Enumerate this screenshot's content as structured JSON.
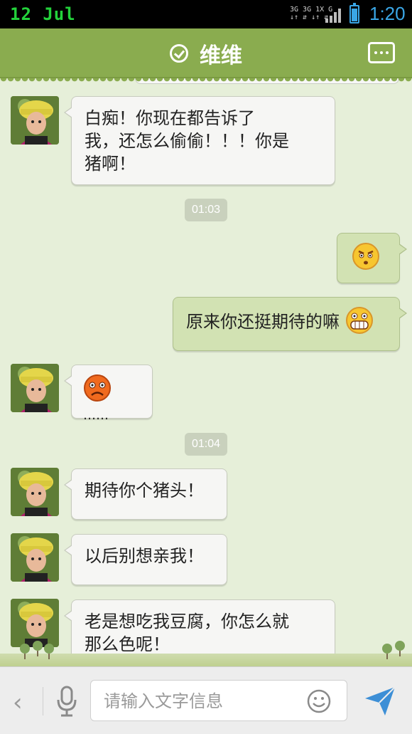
{
  "status_bar": {
    "date": "12  Jul",
    "network_top": "3G 3G 1X  G",
    "network_bottom": "↓↑ ⇵ ↓↑ ⇵",
    "time": "1:20",
    "battery_level": 0.8
  },
  "header": {
    "title": "维维",
    "check_icon": "check-circle-icon",
    "menu_icon": "more-dots-icon"
  },
  "messages": [
    {
      "side": "in",
      "text_line1": "白痴！你现在都告诉了",
      "text_line2": "我，还怎么偷偷！！！你是",
      "text_line3": "猪啊！"
    },
    {
      "timestamp": "01:03"
    },
    {
      "side": "out",
      "emoji": "angry-face-icon"
    },
    {
      "side": "out",
      "text": "原来你还挺期待的嘛",
      "emoji": "grin-face-icon"
    },
    {
      "side": "in",
      "emoji": "frown-face-icon",
      "text": "……"
    },
    {
      "timestamp": "01:04"
    },
    {
      "side": "in",
      "text": "期待你个猪头！"
    },
    {
      "side": "in",
      "text": "以后别想亲我！"
    },
    {
      "side": "in",
      "text_line1": "老是想吃我豆腐，你怎么就",
      "text_line2": "那么色呢！"
    }
  ],
  "input_bar": {
    "placeholder": "请输入文字信息",
    "back_glyph": "‹",
    "mic_icon": "microphone-icon",
    "emoji_icon": "smiley-icon",
    "send_icon": "send-icon"
  },
  "colors": {
    "header": "#8aac4f",
    "chat_bg": "#e6efd9",
    "in_bubble": "#f6f6f4",
    "out_bubble": "#d2e2b3",
    "accent": "#3aa6e6"
  }
}
